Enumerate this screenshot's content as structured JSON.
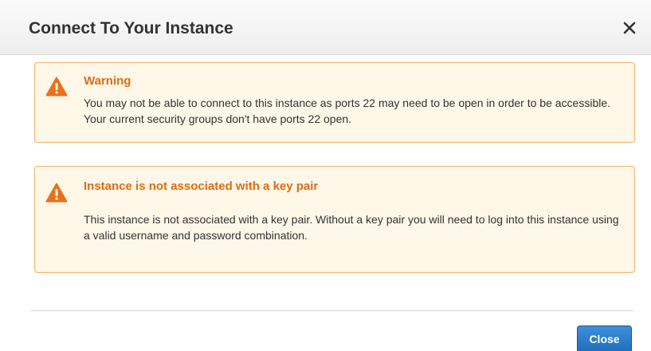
{
  "dialog": {
    "title": "Connect To Your Instance",
    "close_icon": "close-x-icon"
  },
  "alerts": [
    {
      "icon": "warning-triangle-icon",
      "title": "Warning",
      "body": "You may not be able to connect to this instance as ports 22 may need to be open in order to be accessible. Your current security groups don't have ports 22 open."
    },
    {
      "icon": "warning-triangle-icon",
      "title": "Instance is not associated with a key pair",
      "body": "This instance is not associated with a key pair. Without a key pair you will need to log into this instance using a valid username and password combination."
    }
  ],
  "footer": {
    "close_label": "Close"
  },
  "colors": {
    "alert_background": "#fff7e8",
    "alert_border": "#f0b36a",
    "alert_title": "#dd6d14",
    "warning_icon": "#e8711b",
    "primary_button": "#2a7bc9"
  }
}
